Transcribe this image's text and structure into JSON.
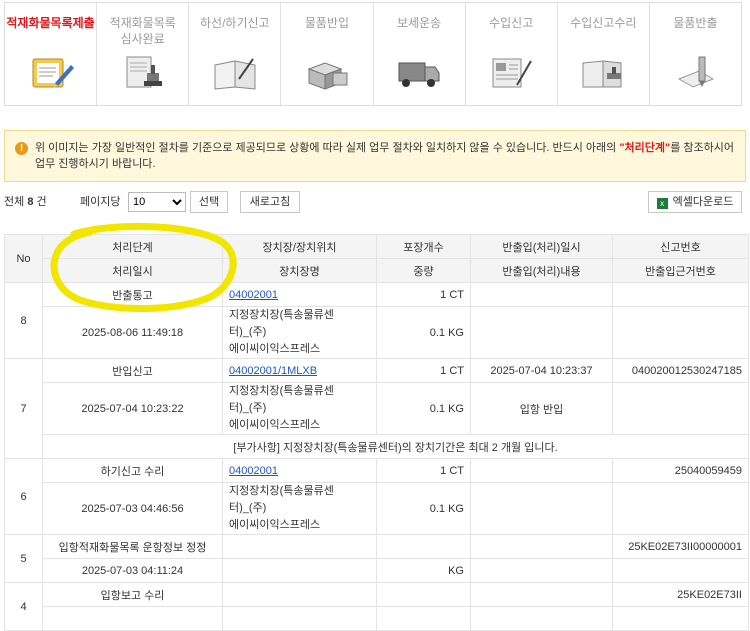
{
  "steps": [
    {
      "label": "적재화물목록제출",
      "icon": "clipboard-pencil-icon",
      "active": true
    },
    {
      "label": "적재화물목록\n심사완료",
      "icon": "document-stamp-icon",
      "active": false
    },
    {
      "label": "하선/하기신고",
      "icon": "open-book-pen-icon",
      "active": false
    },
    {
      "label": "물품반입",
      "icon": "boxes-icon",
      "active": false
    },
    {
      "label": "보세운송",
      "icon": "truck-icon",
      "active": false
    },
    {
      "label": "수입신고",
      "icon": "report-pen-icon",
      "active": false
    },
    {
      "label": "수입신고수리",
      "icon": "book-stamp-icon",
      "active": false
    },
    {
      "label": "물품반출",
      "icon": "pen-paper-icon",
      "active": false
    }
  ],
  "notice": {
    "text_before": "위 이미지는 가장 일반적인 절차를 기준으로 제공되므로 상황에 따라 실제 업무 절차와 일치하지 않을 수 있습니다. 반드시 아래의 ",
    "highlight": "\"처리단계\"",
    "text_after": "를 참조하시어 업무 진행하시기 바랍니다."
  },
  "toolbar": {
    "total_prefix": "전체",
    "total_count": "8",
    "total_suffix": "건",
    "per_page_label": "페이지당",
    "per_page_value": "10",
    "select_button": "선택",
    "refresh_button": "새로고침",
    "excel_button": "엑셀다운로드"
  },
  "table": {
    "headers_row1": [
      "No",
      "처리단계",
      "장치장/장치위치",
      "포장개수",
      "반출입(처리)일시",
      "신고번호"
    ],
    "headers_row2": [
      "처리일시",
      "장치장명",
      "중량",
      "반출입(처리)내용",
      "반출입근거번호"
    ],
    "rows": [
      {
        "no": "8",
        "step": "반출통고",
        "location": "04002001",
        "pkg": "1 CT",
        "io_datetime": "",
        "decl_no": "",
        "proc_datetime": "2025-08-06 11:49:18",
        "warehouse_line1": "지정장치장(특송물류센터)_(주)",
        "warehouse_line2": "에이씨이익스프레스",
        "weight": "0.1 KG",
        "io_content": "",
        "basis_no": ""
      },
      {
        "no": "7",
        "step": "반입신고",
        "location": "04002001/1MLXB",
        "pkg": "1 CT",
        "io_datetime": "2025-07-04 10:23:37",
        "decl_no": "040020012530247185",
        "proc_datetime": "2025-07-04 10:23:22",
        "warehouse_line1": "지정장치장(특송물류센터)_(주)",
        "warehouse_line2": "에이씨이익스프레스",
        "weight": "0.1 KG",
        "io_content": "입항 반입",
        "basis_no": "",
        "note": "[부가사항] 지정장치장(특송물류센터)의 장치기간은 최대 2 개월 입니다."
      },
      {
        "no": "6",
        "step": "하기신고 수리",
        "location": "04002001",
        "pkg": "1 CT",
        "io_datetime": "",
        "decl_no": "25040059459",
        "proc_datetime": "2025-07-03 04:46:56",
        "warehouse_line1": "지정장치장(특송물류센터)_(주)",
        "warehouse_line2": "에이씨이익스프레스",
        "weight": "0.1 KG",
        "io_content": "",
        "basis_no": ""
      },
      {
        "no": "5",
        "step": "입항적재화물목록 운항정보 정정",
        "location": "",
        "pkg": "",
        "io_datetime": "",
        "decl_no": "25KE02E73II00000001",
        "proc_datetime": "2025-07-03 04:11:24",
        "warehouse_line1": "",
        "warehouse_line2": "",
        "weight": "KG",
        "io_content": "",
        "basis_no": ""
      },
      {
        "no": "4",
        "step": "입항보고 수리",
        "location": "",
        "pkg": "",
        "io_datetime": "",
        "decl_no": "25KE02E73II",
        "proc_datetime": "",
        "warehouse_line1": "",
        "warehouse_line2": "",
        "weight": "",
        "io_content": "",
        "basis_no": ""
      }
    ]
  },
  "colors": {
    "active_step": "#e0191f",
    "link": "#1a56c9",
    "notice_bg": "#fff8dc",
    "marker": "#f2e600"
  }
}
